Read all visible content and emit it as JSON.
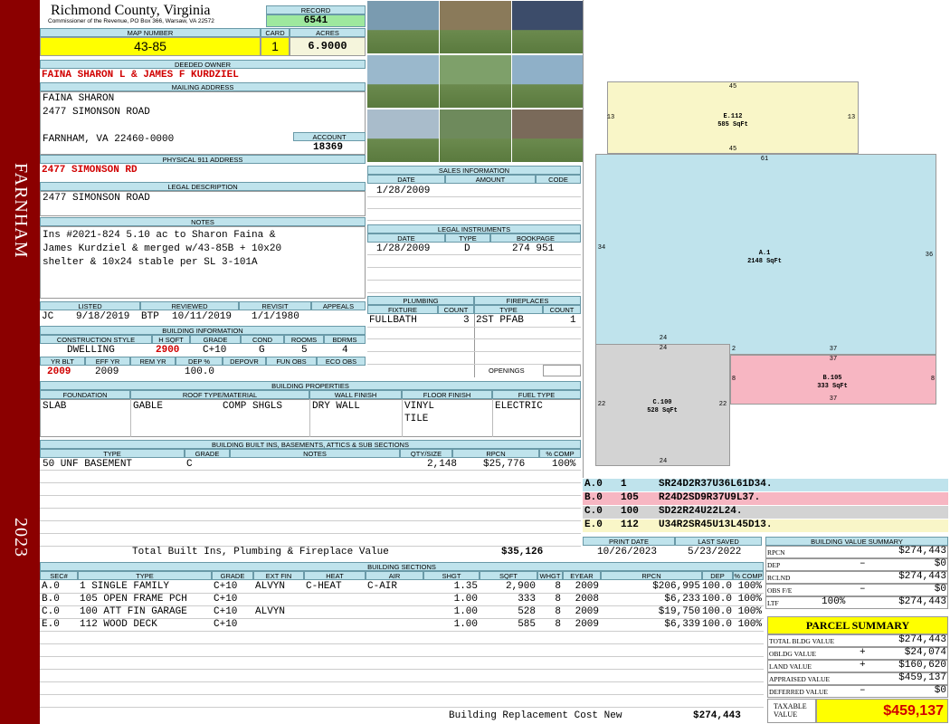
{
  "band": {
    "city": "FARNHAM",
    "year": "2023"
  },
  "header": {
    "county": "Richmond County, Virginia",
    "commissioner": "Commissioner of the Revenue, PO Box 366, Warsaw, VA 22572",
    "record_label": "RECORD",
    "record": "6541",
    "map_label": "MAP NUMBER",
    "map": "43-85",
    "card_label": "CARD",
    "card": "1",
    "acres_label": "ACRES",
    "acres": "6.9000"
  },
  "owner": {
    "label": "DEEDED OWNER",
    "name": "FAINA SHARON L & JAMES F KURDZIEL"
  },
  "mailing": {
    "label": "MAILING ADDRESS",
    "line1": "FAINA SHARON",
    "line2": "2477 SIMONSON ROAD",
    "line3": "FARNHAM, VA 22460-0000",
    "account_label": "ACCOUNT",
    "account": "18369"
  },
  "physical": {
    "label": "PHYSICAL 911 ADDRESS",
    "value": "2477 SIMONSON RD"
  },
  "legal": {
    "label": "LEGAL DESCRIPTION",
    "value": "2477 SIMONSON ROAD"
  },
  "notes": {
    "label": "NOTES",
    "line1": "Ins #2021-824 5.10 ac to Sharon Faina &",
    "line2": "James Kurdziel & merged w/43-85B + 10x20",
    "line3": "shelter & 10x24 stable per SL 3-101A"
  },
  "review": {
    "h": [
      "LISTED",
      "REVIEWED",
      "REVISIT",
      "APPEALS"
    ],
    "listed_by": "JC",
    "listed": "9/18/2019",
    "reviewed_by": "BTP",
    "reviewed": "10/11/2019",
    "revisit": "1/1/1980"
  },
  "building": {
    "label": "BUILDING INFORMATION",
    "h": [
      "CONSTRUCTION STYLE",
      "H SQFT",
      "GRADE",
      "COND",
      "ROOMS",
      "BDRMS"
    ],
    "style": "DWELLING",
    "hsqft": "2900",
    "grade": "C+10",
    "cond": "G",
    "rooms": "5",
    "bdrms": "4",
    "h2": [
      "YR BLT",
      "EFF YR",
      "REM YR",
      "DEP %",
      "DEPOVR",
      "FUN OBS",
      "ECO OBS"
    ],
    "yrblt": "2009",
    "effyr": "2009",
    "dep": "100.0"
  },
  "props": {
    "label": "BUILDING PROPERTIES",
    "h": [
      "FOUNDATION",
      "ROOF TYPE/MATERIAL",
      "WALL FINISH",
      "FLOOR FINISH",
      "FUEL TYPE"
    ],
    "foundation": "SLAB",
    "roof1": "GABLE",
    "roof2": "COMP SHGLS",
    "wall": "DRY WALL",
    "floor1": "VINYL",
    "floor2": "TILE",
    "fuel": "ELECTRIC"
  },
  "builtins": {
    "label": "BUILDING BUILT INS, BASEMENTS, ATTICS & SUB SECTIONS",
    "h": [
      "TYPE",
      "GRADE",
      "NOTES",
      "QTY/SIZE",
      "RPCN",
      "% COMP"
    ],
    "type": "50 UNF BASEMENT",
    "grade": "C",
    "qty": "2,148",
    "rpcn": "$25,776",
    "comp": "100%",
    "total_label": "Total Built Ins, Plumbing & Fireplace Value",
    "total": "$35,126"
  },
  "sales": {
    "label": "SALES INFORMATION",
    "h": [
      "DATE",
      "AMOUNT",
      "CODE"
    ],
    "date": "1/28/2009"
  },
  "instruments": {
    "label": "LEGAL INSTRUMENTS",
    "h": [
      "DATE",
      "TYPE",
      "BOOKPAGE"
    ],
    "date": "1/28/2009",
    "type": "D",
    "bookpage": "274 951"
  },
  "plumbing": {
    "label": "PLUMBING",
    "h": [
      "FIXTURE",
      "COUNT"
    ],
    "fixture": "FULLBATH",
    "count": "3"
  },
  "fireplaces": {
    "label": "FIREPLACES",
    "h": [
      "TYPE",
      "COUNT"
    ],
    "type": "2ST PFAB",
    "count": "1",
    "openings": "OPENINGS"
  },
  "sketch": {
    "e_label": "E.112",
    "e_area": "585 SqFt",
    "a_label": "A.1",
    "a_area": "2148 SqFt",
    "b_label": "B.105",
    "b_area": "333 SqFt",
    "c_label": "C.100",
    "c_area": "528 SqFt",
    "dims": {
      "e_top": "45",
      "e_bot": "45",
      "e_l": "13",
      "e_r": "13",
      "a_top": "61",
      "a_l": "34",
      "a_r": "36",
      "c_top": "24",
      "c_top2": "24",
      "c_l": "22",
      "c_r": "22",
      "c_bot": "24",
      "b_top": "37",
      "b_l": "8",
      "b_r": "8",
      "b_bot": "37",
      "b_2": "2"
    }
  },
  "sketch_legend": [
    {
      "code": "A.0",
      "n": "1",
      "vec": "SR24D2R37U36L61D34.",
      "color": "#bfe3ec"
    },
    {
      "code": "B.0",
      "n": "105",
      "vec": "R24D2SD9R37U9L37.",
      "color": "#f7b6c2"
    },
    {
      "code": "C.0",
      "n": "100",
      "vec": "SD22R24U22L24.",
      "color": "#d3d3d3"
    },
    {
      "code": "E.0",
      "n": "112",
      "vec": "U34R2SR45U13L45D13.",
      "color": "#f9f6c8"
    }
  ],
  "dates": {
    "print_label": "PRINT DATE",
    "print": "10/26/2023",
    "saved_label": "LAST SAVED",
    "saved": "5/23/2022"
  },
  "sections": {
    "label": "BUILDING SECTIONS",
    "h": [
      "SEC#",
      "TYPE",
      "GRADE",
      "EXT FIN",
      "HEAT",
      "AIR",
      "SHGT",
      "SQFT",
      "WHGT",
      "EYEAR",
      "RPCN",
      "DEP",
      "% COMP"
    ],
    "rows": [
      [
        "A.0",
        "1 SINGLE FAMILY",
        "C+10",
        "ALVYN",
        "C-HEAT",
        "C-AIR",
        "1.35",
        "2,900",
        "8",
        "2009",
        "$206,995",
        "100.0",
        "100%"
      ],
      [
        "B.0",
        "105 OPEN FRAME PCH",
        "C+10",
        "",
        "",
        "",
        "1.00",
        "333",
        "8",
        "2008",
        "$6,233",
        "100.0",
        "100%"
      ],
      [
        "C.0",
        "100 ATT FIN GARAGE",
        "C+10",
        "ALVYN",
        "",
        "",
        "1.00",
        "528",
        "8",
        "2009",
        "$19,750",
        "100.0",
        "100%"
      ],
      [
        "E.0",
        "112 WOOD DECK",
        "C+10",
        "",
        "",
        "",
        "1.00",
        "585",
        "8",
        "2009",
        "$6,339",
        "100.0",
        "100%"
      ]
    ],
    "total_label": "Building Replacement Cost New",
    "total": "$274,443"
  },
  "bvs": {
    "label": "BUILDING VALUE SUMMARY",
    "rows": [
      [
        "RPCN",
        "",
        "$274,443"
      ],
      [
        "DEP",
        "–",
        "$0"
      ],
      [
        "RCLND",
        "",
        "$274,443"
      ],
      [
        "OBS F/E",
        "–",
        "$0"
      ],
      [
        "LTF",
        "100%",
        "$274,443"
      ]
    ]
  },
  "parcel": {
    "label": "PARCEL SUMMARY",
    "rows": [
      [
        "TOTAL BLDG VALUE",
        "",
        "$274,443"
      ],
      [
        "OBLDG VALUE",
        "+",
        "$24,074"
      ],
      [
        "LAND VALUE",
        "+",
        "$160,620"
      ],
      [
        "APPRAISED VALUE",
        "",
        "$459,137"
      ],
      [
        "DEFERRED VALUE",
        "–",
        "$0"
      ]
    ],
    "taxable_label1": "TAXABLE",
    "taxable_label2": "VALUE",
    "taxable": "$459,137"
  },
  "photos": [
    "house-photo",
    "shed-photo",
    "house-night-photo",
    "waterfront-photo",
    "shoreline-photo",
    "dock-photo",
    "house-side-photo",
    "pavilion-photo",
    "barn-photo"
  ]
}
